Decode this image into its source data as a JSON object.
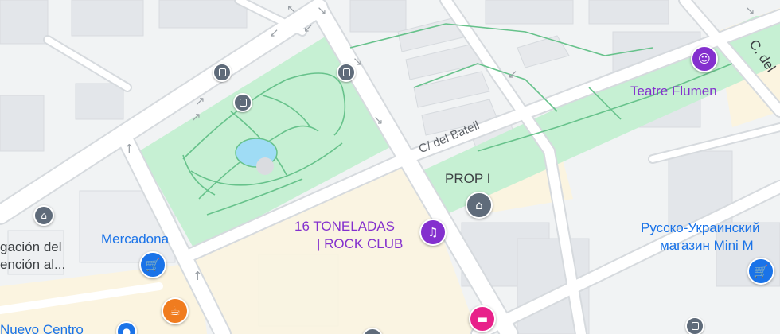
{
  "map": {
    "colors": {
      "background": "#f1f3f4",
      "park": "#c6f0d3",
      "park_path": "#67c28b",
      "road": "#ffffff",
      "road_edge": "#d6dade",
      "building": "#e3e6ea",
      "commercial": "#fbf4e0",
      "water": "#9fdcf5",
      "poi_blue": "#1a73e8",
      "poi_purple": "#8430ce",
      "poi_pink": "#e8218a",
      "poi_orange": "#f07c1f",
      "poi_gray": "#5f6b7a"
    },
    "labels": {
      "mercadona": "Mercadona",
      "teatre_flumen": "Teatre Flumen",
      "prop_i": "PROP I",
      "rock_club_line1": "16 TONELADAS",
      "rock_club_line2": "| ROCK CLUB",
      "russian_store_line1": "Русско-Украинский",
      "russian_store_line2": "магазин Mini M",
      "congregation_line1": "gación del",
      "congregation_line2": "ención al...",
      "nuevo_centro": "Nuevo Centro",
      "street_batell": "C/ del Batell",
      "street_top_right": "C. del"
    },
    "icons": {
      "mercadona": "shopping-cart-icon",
      "russian_store": "shopping-cart-icon",
      "teatre_flumen": "theater-masks-icon",
      "rock_club": "music-note-icon",
      "prop_i": "landmark-icon",
      "congregation": "landmark-icon",
      "cafe": "coffee-cup-icon",
      "hotel": "bed-icon",
      "bus_stop": "bus-icon",
      "direction": "one-way-arrow-icon"
    }
  }
}
